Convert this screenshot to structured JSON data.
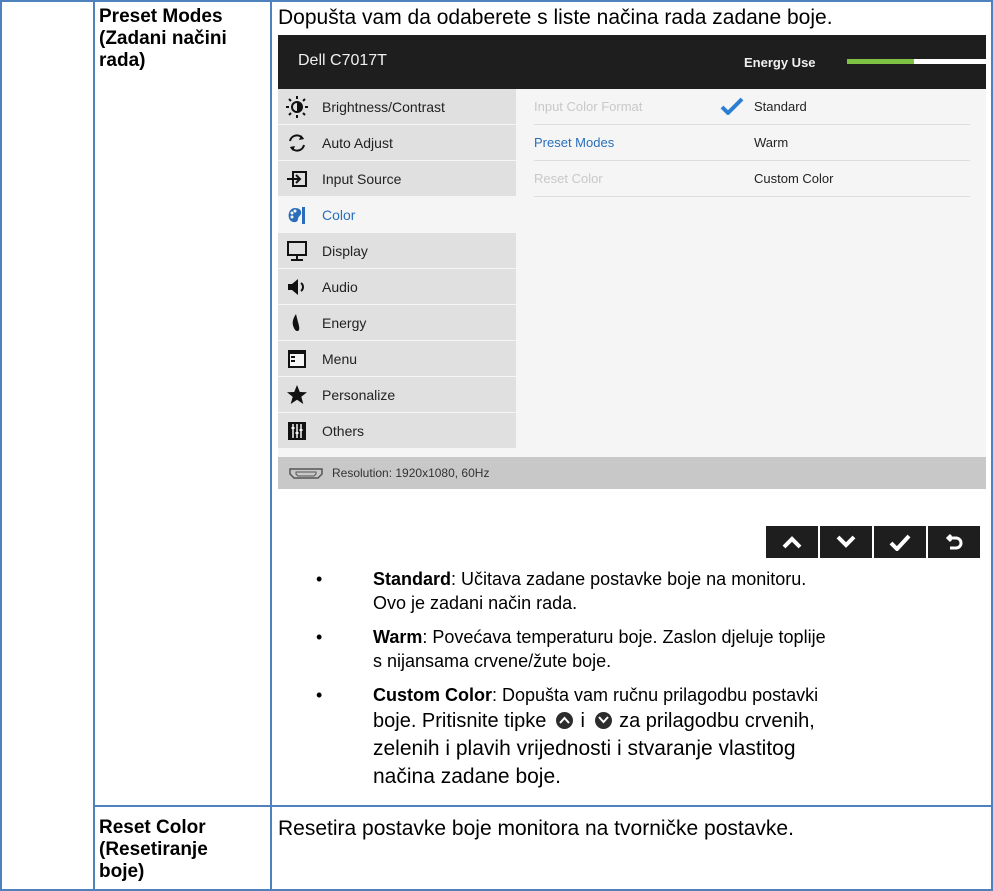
{
  "rows": [
    {
      "label_line1": "Preset Modes",
      "label_line2": "(Zadani načini",
      "label_line3": "rada)",
      "description": "Dopušta vam da odaberete s liste načina rada zadane boje."
    },
    {
      "label_line1": "Reset Color",
      "label_line2": "(Resetiranje",
      "label_line3": "boje)",
      "description": "Resetira postavke boje monitora na tvorničke postavke."
    }
  ],
  "osd": {
    "model": "Dell C7017T",
    "energy_label": "Energy Use",
    "energy_level_percent": 48,
    "menu": [
      {
        "label": "Brightness/Contrast",
        "icon": "brightness-icon",
        "active": false
      },
      {
        "label": "Auto Adjust",
        "icon": "auto-adjust-icon",
        "active": false
      },
      {
        "label": "Input Source",
        "icon": "input-source-icon",
        "active": false
      },
      {
        "label": "Color",
        "icon": "color-icon",
        "active": true
      },
      {
        "label": "Display",
        "icon": "display-icon",
        "active": false
      },
      {
        "label": "Audio",
        "icon": "audio-icon",
        "active": false
      },
      {
        "label": "Energy",
        "icon": "energy-icon",
        "active": false
      },
      {
        "label": "Menu",
        "icon": "menu-icon",
        "active": false
      },
      {
        "label": "Personalize",
        "icon": "star-icon",
        "active": false
      },
      {
        "label": "Others",
        "icon": "others-icon",
        "active": false
      }
    ],
    "submenu": [
      {
        "label": "Input Color Format",
        "state": "disabled",
        "value": "Standard",
        "checked": true
      },
      {
        "label": "Preset Modes",
        "state": "selected",
        "value": "Warm",
        "checked": false
      },
      {
        "label": "Reset Color",
        "state": "disabled",
        "value": "Custom Color",
        "checked": false
      }
    ],
    "resolution": "Resolution: 1920x1080, 60Hz",
    "nav_buttons": [
      "up-arrow-icon",
      "down-arrow-icon",
      "check-icon",
      "back-icon"
    ]
  },
  "bullets": {
    "standard": {
      "term": "Standard",
      "line1": ": Učitava zadane postavke boje na monitoru.",
      "line2": "Ovo je zadani način rada."
    },
    "warm": {
      "term": "Warm",
      "line1": ": Povećava temperaturu boje. Zaslon djeluje toplije",
      "line2": "s nijansama crvene/žute boje."
    },
    "custom": {
      "term": "Custom Color",
      "line1": ": Dopušta vam ručnu prilagodbu postavki",
      "line2_a": "boje. Pritisnite tipke",
      "line2_b": "i",
      "line2_c": "za prilagodbu crvenih,",
      "line3": "zelenih i plavih vrijednosti i stvaranje vlastitog",
      "line4": "načina zadane boje."
    }
  },
  "colors": {
    "table_border": "#4f81bd",
    "osd_header": "#1e1e1e",
    "energy_bar": "#7dc242",
    "accent_blue": "#2a6ebb",
    "check_blue": "#2a7fd4"
  }
}
